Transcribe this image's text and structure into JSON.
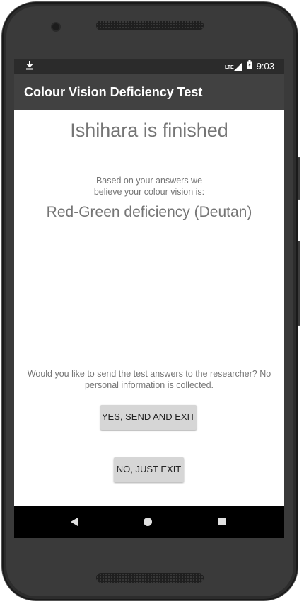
{
  "status_bar": {
    "download_icon": "download-icon",
    "network_label": "LTE",
    "signal_icon": "signal-icon",
    "battery_icon": "battery-icon",
    "time": "9:03"
  },
  "app_bar": {
    "title": "Colour Vision Deficiency Test"
  },
  "result_screen": {
    "headline": "Ishihara is finished",
    "intro_line1": "Based on your answers we",
    "intro_line2": "believe your colour vision is:",
    "result": "Red-Green deficiency (Deutan)",
    "question_line1": "Would you like to send the test answers to the researcher? No",
    "question_line2": "personal information is collected.",
    "yes_button": "YES, SEND AND EXIT",
    "no_button": "NO, JUST EXIT"
  },
  "navigation": {
    "back_icon": "back-icon",
    "home_icon": "home-icon",
    "recents_icon": "recents-icon"
  },
  "colors": {
    "status_bar": "#2b2b2b",
    "app_bar": "#414141",
    "text_gray": "#757575",
    "button_bg": "#d6d6d6",
    "nav_bar": "#000000"
  }
}
